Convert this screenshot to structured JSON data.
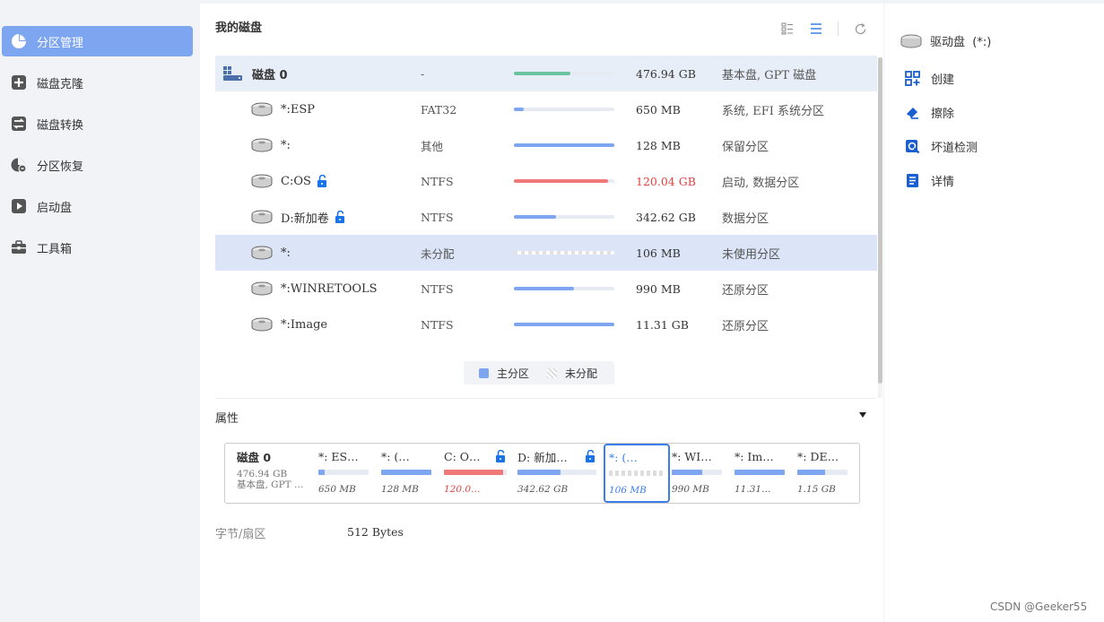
{
  "sidebar": {
    "items": [
      {
        "label": "分区管理",
        "icon": "pie-chart-icon",
        "active": true
      },
      {
        "label": "磁盘克隆",
        "icon": "plus-box-icon"
      },
      {
        "label": "磁盘转换",
        "icon": "convert-icon"
      },
      {
        "label": "分区恢复",
        "icon": "recovery-icon"
      },
      {
        "label": "启动盘",
        "icon": "boot-icon"
      },
      {
        "label": "工具箱",
        "icon": "toolbox-icon"
      }
    ]
  },
  "main": {
    "title": "我的磁盘",
    "toolbar": [
      "tile-view-icon",
      "list-view-icon",
      "refresh-icon"
    ],
    "disk": {
      "name": "磁盘 0",
      "fs": "-",
      "used_fraction": 0.56,
      "size": "476.94 GB",
      "type": "基本盘, GPT 磁盘"
    },
    "partitions": [
      {
        "name": "*:ESP",
        "fs": "FAT32",
        "used_fraction": 0.1,
        "size": "650 MB",
        "type": "系统, EFI 系统分区",
        "locked": false,
        "color": "#7ea6f0"
      },
      {
        "name": "*:",
        "fs": "其他",
        "used_fraction": 1.0,
        "size": "128 MB",
        "type": "保留分区",
        "locked": false,
        "color": "#7ea6f0"
      },
      {
        "name": "C:OS",
        "fs": "NTFS",
        "used_fraction": 0.94,
        "size": "120.04 GB",
        "type": "启动, 数据分区",
        "locked": true,
        "color": "#f07878",
        "size_red": true
      },
      {
        "name": "D:新加卷",
        "fs": "NTFS",
        "used_fraction": 0.42,
        "size": "342.62 GB",
        "type": "数据分区",
        "locked": true,
        "color": "#7ea6f0"
      },
      {
        "name": "*:",
        "fs": "未分配",
        "used_fraction": 0,
        "size": "106 MB",
        "type": "未使用分区",
        "locked": false,
        "unallocated": true,
        "selected": true
      },
      {
        "name": "*:WINRETOOLS",
        "fs": "NTFS",
        "used_fraction": 0.6,
        "size": "990 MB",
        "type": "还原分区",
        "locked": false,
        "color": "#7ea6f0"
      },
      {
        "name": "*:Image",
        "fs": "NTFS",
        "used_fraction": 1.0,
        "size": "11.31 GB",
        "type": "还原分区",
        "locked": false,
        "color": "#7ea6f0"
      }
    ],
    "legend": {
      "primary": "主分区",
      "unallocated": "未分配"
    },
    "properties_title": "属性",
    "map": {
      "disk_name": "磁盘 0",
      "disk_size": "476.94 GB",
      "disk_type": "基本盘, GPT …",
      "segments": [
        {
          "label": "*: ES…",
          "size": "650 MB",
          "used_fraction": 0.12
        },
        {
          "label": "*: (…",
          "size": "128 MB",
          "used_fraction": 1.0
        },
        {
          "label": "C: O…",
          "size": "120.0…",
          "used_fraction": 0.94,
          "locked": true,
          "red": true
        },
        {
          "label": "D: 新加…",
          "size": "342.62 GB",
          "used_fraction": 0.55,
          "locked": true
        },
        {
          "label": "*: (…",
          "size": "106 MB",
          "used_fraction": 0,
          "unallocated": true,
          "selected": true
        },
        {
          "label": "*: WI…",
          "size": "990 MB",
          "used_fraction": 0.6
        },
        {
          "label": "*: Im…",
          "size": "11.31…",
          "used_fraction": 1.0
        },
        {
          "label": "*: DE…",
          "size": "1.15 GB",
          "used_fraction": 0.55
        }
      ]
    },
    "info": {
      "label": "字节/扇区",
      "value": "512 Bytes"
    }
  },
  "right": {
    "header": "驱动盘  (*:)",
    "actions": [
      {
        "label": "创建",
        "icon": "create-icon"
      },
      {
        "label": "擦除",
        "icon": "eraser-icon"
      },
      {
        "label": "坏道检测",
        "icon": "scan-icon"
      },
      {
        "label": "详情",
        "icon": "details-icon"
      }
    ]
  },
  "watermark": "CSDN @Geeker55",
  "colors": {
    "accent": "#7ea6f0",
    "selected_bg": "#dbe5f7",
    "danger": "#e04040",
    "disk_bar": "#6cc3a0"
  }
}
